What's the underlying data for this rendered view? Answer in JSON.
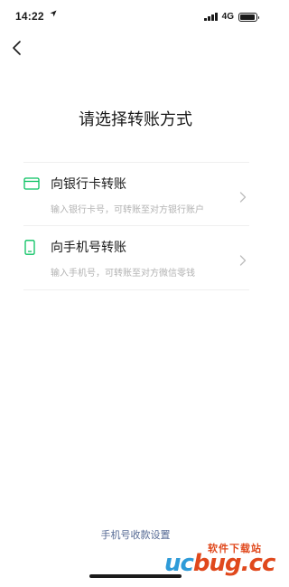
{
  "status": {
    "time": "14:22",
    "network": "4G"
  },
  "page": {
    "title": "请选择转账方式"
  },
  "options": [
    {
      "label": "向银行卡转账",
      "sub": "输入银行卡号，可转账至对方银行账户",
      "icon": "bank-card-icon"
    },
    {
      "label": "向手机号转账",
      "sub": "输入手机号，可转账至对方微信零钱",
      "icon": "mobile-phone-icon"
    }
  ],
  "footer": {
    "link": "手机号收款设置"
  },
  "watermark": {
    "site": "软件下载站",
    "logo_a": "uc",
    "logo_b": "bug.cc"
  },
  "colors": {
    "accent": "#07c160",
    "link": "#576b95",
    "muted": "#b3b3b3"
  }
}
